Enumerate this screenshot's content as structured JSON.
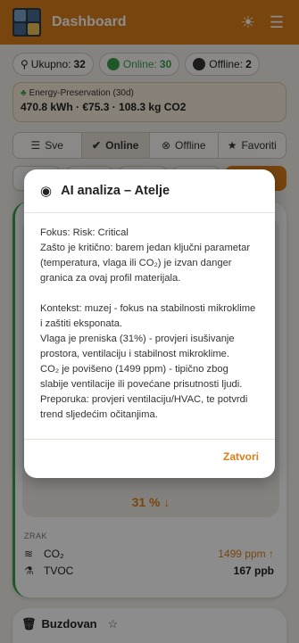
{
  "header": {
    "title": "Dashboard"
  },
  "stats": [
    {
      "label": "Ukupno:",
      "value": "32",
      "color": "#555555"
    },
    {
      "label": "Online:",
      "value": "30",
      "color": "#3aa049"
    },
    {
      "label": "Offline:",
      "value": "2",
      "color": "#333333"
    }
  ],
  "energy": {
    "label": "Energy-Preservation (30d)",
    "value": "470.8 kWh · €75.3 · 108.3 kg CO2"
  },
  "tabs": [
    {
      "label": "Sve",
      "icon": "list-icon"
    },
    {
      "label": "Online",
      "icon": "check-circle-icon",
      "active": true
    },
    {
      "label": "Offline",
      "icon": "x-circle-icon"
    },
    {
      "label": "Favoriti",
      "icon": "star-icon"
    }
  ],
  "card": {
    "trend": "31 % ↓",
    "section": "ZRAK",
    "rows": [
      {
        "label": "CO₂",
        "value": "1499 ppm ↑",
        "warn": true
      },
      {
        "label": "TVOC",
        "value": "167 ppb",
        "warn": false
      }
    ]
  },
  "card2": {
    "title": "Buzdovan"
  },
  "modal": {
    "title": "AI analiza – Atelje",
    "paragraphs": [
      "Fokus: Risk: Critical",
      "Zašto je kritično: barem jedan ključni parametar (temperatura, vlaga ili CO₂) je izvan danger granica za ovaj profil materijala.",
      "",
      "Kontekst: muzej - fokus na stabilnosti mikroklime i zaštiti eksponata.",
      "Vlaga je preniska (31%) - provjeri isušivanje prostora, ventilaciju i stabilnost mikroklime.",
      "CO₂ je povišeno (1499 ppm) - tipično zbog slabije ventilacije ili povećane prisutnosti ljudi.",
      "Preporuka: provjeri ventilaciju/HVAC, te potvrdi trend sljedećim očitanjima."
    ],
    "close_label": "Zatvori"
  },
  "colors": {
    "accent": "#dd7f1a",
    "online": "#3aa049"
  }
}
